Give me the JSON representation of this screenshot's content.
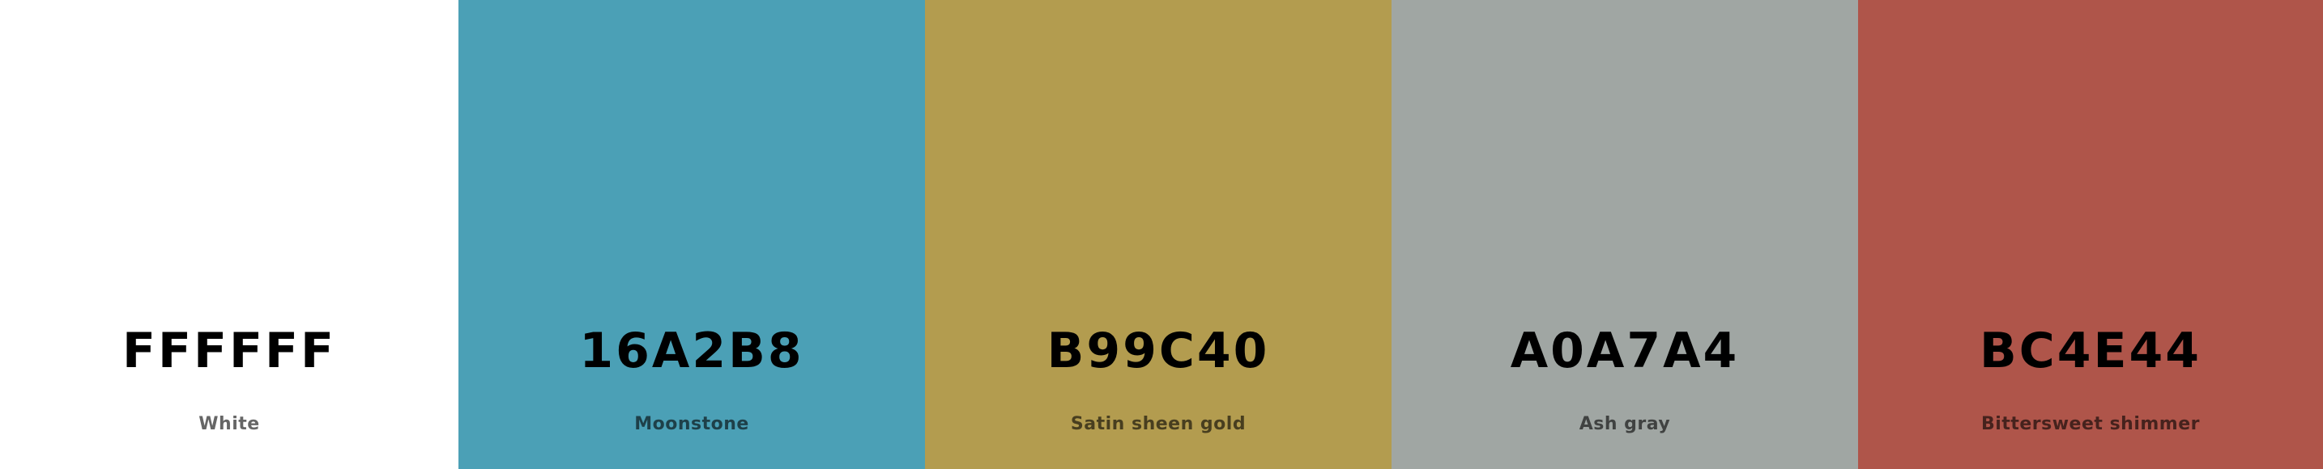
{
  "swatches": [
    {
      "hex": "FFFFFF",
      "name": "White",
      "color": "#FFFFFF"
    },
    {
      "hex": "16A2B8",
      "name": "Moonstone",
      "color": "#4BA0B6"
    },
    {
      "hex": "B99C40",
      "name": "Satin sheen gold",
      "color": "#B39C4F"
    },
    {
      "hex": "A0A7A4",
      "name": "Ash gray",
      "color": "#A0A6A3"
    },
    {
      "hex": "BC4E44",
      "name": "Bittersweet shimmer",
      "color": "#AF554A"
    }
  ]
}
